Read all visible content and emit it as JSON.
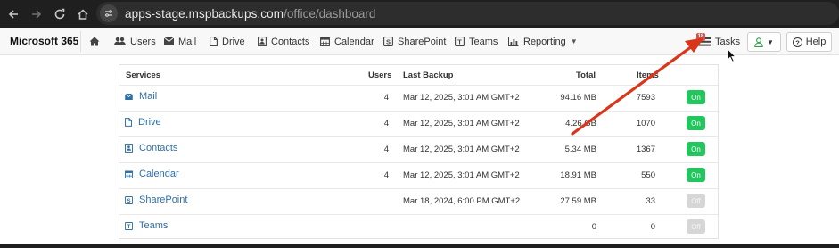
{
  "browser": {
    "url_host": "apps-stage.mspbackups.com",
    "url_path": "/office/dashboard"
  },
  "nav": {
    "brand": "Microsoft 365",
    "items": [
      {
        "label": "Users",
        "icon": "users-icon"
      },
      {
        "label": "Mail",
        "icon": "envelope-icon"
      },
      {
        "label": "Drive",
        "icon": "file-icon"
      },
      {
        "label": "Contacts",
        "icon": "contact-card-icon"
      },
      {
        "label": "Calendar",
        "icon": "calendar-icon"
      },
      {
        "label": "SharePoint",
        "icon": "sharepoint-icon"
      },
      {
        "label": "Teams",
        "icon": "teams-icon"
      },
      {
        "label": "Reporting",
        "icon": "bar-chart-icon"
      }
    ],
    "tasks_label": "Tasks",
    "tasks_badge": "18",
    "help_label": "Help"
  },
  "table": {
    "headers": {
      "services": "Services",
      "users": "Users",
      "last_backup": "Last Backup",
      "total": "Total",
      "items": "Items"
    },
    "rows": [
      {
        "service": "Mail",
        "users": "4",
        "last_backup": "Mar 12, 2025, 3:01 AM GMT+2",
        "total": "94.16 MB",
        "items": "7593",
        "status": "On"
      },
      {
        "service": "Drive",
        "users": "4",
        "last_backup": "Mar 12, 2025, 3:01 AM GMT+2",
        "total": "4.26 GB",
        "items": "1070",
        "status": "On"
      },
      {
        "service": "Contacts",
        "users": "4",
        "last_backup": "Mar 12, 2025, 3:01 AM GMT+2",
        "total": "5.34 MB",
        "items": "1367",
        "status": "On"
      },
      {
        "service": "Calendar",
        "users": "4",
        "last_backup": "Mar 12, 2025, 3:01 AM GMT+2",
        "total": "18.91 MB",
        "items": "550",
        "status": "On"
      },
      {
        "service": "SharePoint",
        "users": "",
        "last_backup": "Mar 18, 2024, 6:00 PM GMT+2",
        "total": "27.59 MB",
        "items": "33",
        "status": "Off"
      },
      {
        "service": "Teams",
        "users": "",
        "last_backup": "",
        "total": "0",
        "items": "0",
        "status": "Off"
      }
    ]
  },
  "colors": {
    "link": "#2f6fa7",
    "toggle_on": "#22c55e",
    "toggle_off": "#d6d6d6",
    "annotation_arrow": "#d9361c",
    "user_icon": "#2ea44f"
  }
}
